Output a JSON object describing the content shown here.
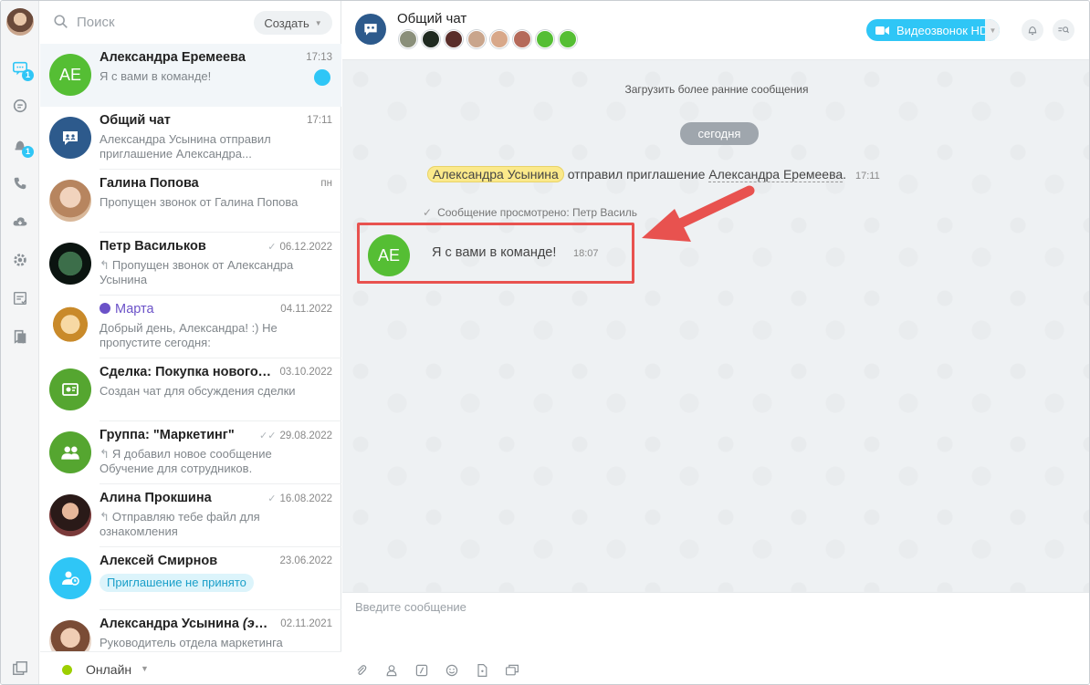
{
  "sidebar": {
    "chat_badge": "1",
    "notify_badge": "1"
  },
  "search": {
    "placeholder": "Поиск"
  },
  "create_label": "Создать",
  "chats": [
    {
      "title": "Александра Еремеева",
      "date": "17:13",
      "sub": "Я с вами в команде!",
      "initials": "АЕ",
      "avatar_color": "#55be34",
      "unread": true
    },
    {
      "title": "Общий чат",
      "date": "17:11",
      "sub": "Александра Усынина отправил приглашение Александра...",
      "avatar_color": "#2d5a8c"
    },
    {
      "title": "Галина Попова",
      "date": "пн",
      "sub": "Пропущен звонок от Галина Попова",
      "avatar_color": "#c99a7a"
    },
    {
      "title": "Петр Васильков",
      "date": "06.12.2022",
      "sub": "Пропущен звонок от Александра Усынина",
      "avatar_color": "#1e3b2c",
      "checked": true,
      "reply": true
    },
    {
      "title": "Марта",
      "date": "04.11.2022",
      "sub": "Добрый день, Александра! :) Не пропустите сегодня:",
      "avatar_color": "#f2c94c"
    },
    {
      "title": "Сделка: Покупка новогод...",
      "date": "03.10.2022",
      "sub": "Создан чат для обсуждения сделки",
      "avatar_color": "#55a630"
    },
    {
      "title": "Группа: \"Маркетинг\"",
      "date": "29.08.2022",
      "sub": "Я добавил новое сообщение Обучение для сотрудников.",
      "avatar_color": "#55a630",
      "checked": true,
      "reply": true
    },
    {
      "title": "Алина Прокшина",
      "date": "16.08.2022",
      "sub": "Отправляю тебе файл для ознакомления",
      "avatar_color": "#3b2a2a",
      "checked": true,
      "reply": true
    },
    {
      "title": "Алексей Смирнов",
      "date": "23.06.2022",
      "tag": "Приглашение не принято",
      "avatar_color": "#2fc6f6"
    },
    {
      "title_main": "Александра Усынина ",
      "title_italic": "(это...",
      "date": "02.11.2021",
      "sub": "Руководитель отдела маркетинга",
      "avatar_color": "#d8a88a"
    }
  ],
  "status": {
    "label": "Онлайн",
    "color": "#9dcf00"
  },
  "header": {
    "title": "Общий чат",
    "video_label": "Видеозвонок HD",
    "member_colors": [
      "#8a8f7a",
      "#1f2a20",
      "#5a2e2a",
      "#c9a58c",
      "#d8a88a",
      "#b56a5a",
      "#55be34",
      "#55be34"
    ]
  },
  "messages": {
    "load_more": "Загрузить более ранние сообщения",
    "date_divider": "сегодня",
    "system_author": "Александра Усынина",
    "system_action": " отправил приглашение ",
    "system_target": "Александра Еремеева",
    "system_dot": ".",
    "system_time": "17:11",
    "seen": "Сообщение просмотрено: Петр Василь",
    "msg_initials": "АЕ",
    "msg_text": "Я с вами в команде!",
    "msg_time": "18:07"
  },
  "composer": {
    "placeholder": "Введите сообщение"
  },
  "colors": {
    "accent": "#2fc6f6",
    "highlight": "#e8524f",
    "online": "#9dcf00"
  }
}
